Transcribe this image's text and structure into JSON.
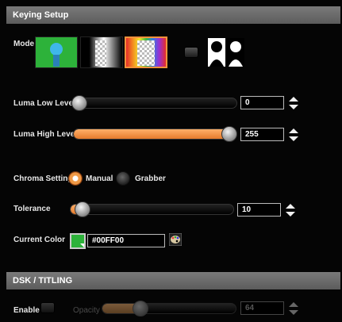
{
  "keying": {
    "title": "Keying Setup",
    "mode_label": "Mode",
    "modes": [
      "green-screen-key",
      "luma-key",
      "chroma-key"
    ],
    "selected_mode": 3,
    "luma_low": {
      "label": "Luma Low Level",
      "value": "0",
      "fraction": 0.0
    },
    "luma_high": {
      "label": "Luma High Level",
      "value": "255",
      "fraction": 1.0
    },
    "chroma": {
      "label": "Chroma Setting",
      "manual": "Manual",
      "grabber": "Grabber",
      "selected": "manual"
    },
    "tolerance": {
      "label": "Tolerance",
      "value": "10",
      "fraction": 0.04
    },
    "current_color": {
      "label": "Current Color",
      "hex": "#00FF00",
      "color": "#2db23a"
    },
    "accent_color": "#f2923a"
  },
  "dsk": {
    "title": "DSK / TITLING",
    "enable_label": "Enable",
    "opacity": {
      "label": "Opacity",
      "value": "64",
      "fraction": 0.25
    }
  }
}
